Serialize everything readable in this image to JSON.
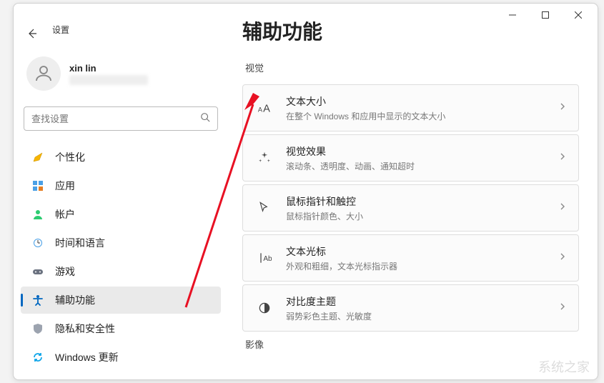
{
  "app_title": "设置",
  "page_title": "辅助功能",
  "user": {
    "name": "xin lin"
  },
  "search": {
    "placeholder": "查找设置"
  },
  "nav": [
    {
      "label": "个性化",
      "icon": "personalize"
    },
    {
      "label": "应用",
      "icon": "apps"
    },
    {
      "label": "帐户",
      "icon": "accounts"
    },
    {
      "label": "时间和语言",
      "icon": "time"
    },
    {
      "label": "游戏",
      "icon": "gaming"
    },
    {
      "label": "辅助功能",
      "icon": "accessibility",
      "active": true
    },
    {
      "label": "隐私和安全性",
      "icon": "privacy"
    },
    {
      "label": "Windows 更新",
      "icon": "update"
    }
  ],
  "sections": [
    {
      "header": "视觉",
      "cards": [
        {
          "title": "文本大小",
          "desc": "在整个 Windows 和应用中显示的文本大小",
          "icon": "text-size"
        },
        {
          "title": "视觉效果",
          "desc": "滚动条、透明度、动画、通知超时",
          "icon": "sparkle"
        },
        {
          "title": "鼠标指针和触控",
          "desc": "鼠标指针颜色、大小",
          "icon": "pointer"
        },
        {
          "title": "文本光标",
          "desc": "外观和粗细，文本光标指示器",
          "icon": "cursor"
        },
        {
          "title": "对比度主题",
          "desc": "弱势彩色主题、光敏度",
          "icon": "contrast"
        }
      ]
    },
    {
      "header": "影像",
      "cards": []
    }
  ],
  "watermark": "系统之家"
}
